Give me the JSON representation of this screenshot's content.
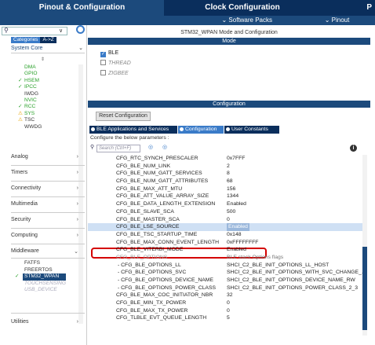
{
  "top_tabs": {
    "pinout": "Pinout & Configuration",
    "clock": "Clock Configuration",
    "p": "P"
  },
  "sub_menu": {
    "software_packs": "Software Packs",
    "pinout": "Pinout"
  },
  "left": {
    "search": {
      "value": "",
      "placeholder": ""
    },
    "category_tabs": [
      "Categories",
      "A->Z"
    ],
    "system_core": "System Core",
    "system_items": [
      {
        "label": "DMA",
        "state": "green"
      },
      {
        "label": "GPIO",
        "state": "green"
      },
      {
        "label": "HSEM",
        "state": "check"
      },
      {
        "label": "IPCC",
        "state": "check"
      },
      {
        "label": "IWDG",
        "state": "dark"
      },
      {
        "label": "NVIC",
        "state": "green"
      },
      {
        "label": "RCC",
        "state": "check"
      },
      {
        "label": "SYS",
        "state": "warn"
      },
      {
        "label": "TSC",
        "state": "warn-dark"
      },
      {
        "label": "WWDG",
        "state": "dark"
      }
    ],
    "categories": [
      "Analog",
      "Timers",
      "Connectivity",
      "Multimedia",
      "Security",
      "Computing",
      "Middleware"
    ],
    "middleware_items": [
      {
        "label": "FATFS",
        "state": "normal"
      },
      {
        "label": "FREERTOS",
        "state": "normal"
      },
      {
        "label": "STM32_WPAN",
        "state": "selected"
      },
      {
        "label": "TOUCHSENSING",
        "state": "disabled"
      },
      {
        "label": "USB_DEVICE",
        "state": "disabled"
      }
    ],
    "utilities": "Utilities"
  },
  "main": {
    "title": "STM32_WPAN Mode and Configuration",
    "mode_header": "Mode",
    "modes": [
      {
        "label": "BLE",
        "checked": true
      },
      {
        "label": "THREAD",
        "checked": false
      },
      {
        "label": "ZIGBEE",
        "checked": false
      }
    ],
    "config_header": "Configuration",
    "reset_button": "Reset Configuration",
    "subtabs": [
      "BLE Applications and Services",
      "Configuration",
      "User Constants"
    ],
    "configure_label": "Configure the below parameters :",
    "search_placeholder": "Search (Ctrl+F)",
    "params": [
      {
        "name": "CFG_RTC_SYNCH_PRESCALER",
        "value": "0x7FFF"
      },
      {
        "name": "CFG_BLE_NUM_LINK",
        "value": "2"
      },
      {
        "name": "CFG_BLE_NUM_GATT_SERVICES",
        "value": "8"
      },
      {
        "name": "CFG_BLE_NUM_GATT_ATTRIBUTES",
        "value": "68"
      },
      {
        "name": "CFG_BLE_MAX_ATT_MTU",
        "value": "156"
      },
      {
        "name": "CFG_BLE_ATT_VALUE_ARRAY_SIZE",
        "value": "1344"
      },
      {
        "name": "CFG_BLE_DATA_LENGTH_EXTENSION",
        "value": "Enabled"
      },
      {
        "name": "CFG_BLE_SLAVE_SCA",
        "value": "500"
      },
      {
        "name": "CFG_BLE_MASTER_SCA",
        "value": "0"
      },
      {
        "name": "CFG_BLE_LSE_SOURCE",
        "value": "Enabled"
      },
      {
        "name": "CFG_BLE_TSC_STARTUP_TIME",
        "value": "0x148"
      },
      {
        "name": "CFG_BLE_MAX_CONN_EVENT_LENGTH",
        "value": "0xFFFFFFFF"
      },
      {
        "name": "CFG_BLE_VITERBI_MODE",
        "value": "Enabled"
      },
      {
        "name": "CFG_BLE_OPTIONS",
        "value": "BLE stack Options flags"
      },
      {
        "name": "- CFG_BLE_OPTIONS_LL",
        "value": "SHCI_C2_BLE_INIT_OPTIONS_LL_HOST"
      },
      {
        "name": "- CFG_BLE_OPTIONS_SVC",
        "value": "SHCI_C2_BLE_INIT_OPTIONS_WITH_SVC_CHANGE_..."
      },
      {
        "name": "- CFG_BLE_OPTIONS_DEVICE_NAME",
        "value": "SHCI_C2_BLE_INIT_OPTIONS_DEVICE_NAME_RW"
      },
      {
        "name": "- CFG_BLE_OPTIONS_POWER_CLASS",
        "value": "SHCI_C2_BLE_INIT_OPTIONS_POWER_CLASS_2_3"
      },
      {
        "name": "CFG_BLE_MAX_COC_INITIATOR_NBR",
        "value": "32"
      },
      {
        "name": "CFG_BLE_MIN_TX_POWER",
        "value": "0"
      },
      {
        "name": "CFG_BLE_MAX_TX_POWER",
        "value": "0"
      },
      {
        "name": "CFG_TLBLE_EVT_QUEUE_LENGTH",
        "value": "5"
      }
    ],
    "selected_param": "CFG_BLE_LSE_SOURCE"
  },
  "colors": {
    "header_dark": "#0a2e5c",
    "header_blue": "#1c4a7c",
    "accent": "#3a7bc8",
    "highlight": "#d40000"
  }
}
